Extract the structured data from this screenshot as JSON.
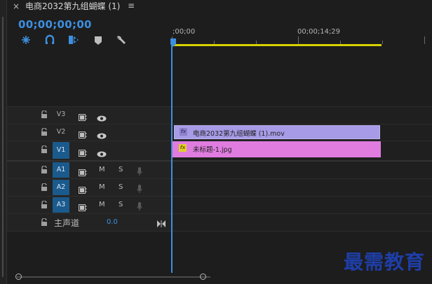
{
  "panel": {
    "close_glyph": "×",
    "title": "电商2032第九组蝴蝶 (1)",
    "menu_glyph": "≡"
  },
  "timecode": "00;00;00;00",
  "tools": [
    "snap-icon",
    "linked-selection-icon",
    "add-marker-icon",
    "marker-icon",
    "wrench-icon"
  ],
  "ruler": {
    "start": ";00;00",
    "mark": "00;00;14;29"
  },
  "tracks": {
    "video": [
      {
        "name": "V3",
        "active": false
      },
      {
        "name": "V2",
        "active": false
      },
      {
        "name": "V1",
        "active": true
      }
    ],
    "audio": [
      {
        "name": "A1",
        "m": "M",
        "s": "S"
      },
      {
        "name": "A2",
        "m": "M",
        "s": "S"
      },
      {
        "name": "A3",
        "m": "M",
        "s": "S"
      }
    ],
    "master": {
      "label": "主声道",
      "value": "0.0"
    }
  },
  "clips": {
    "v2": {
      "fx": "fx",
      "name": "电商2032第九组蝴蝶 (1).mov"
    },
    "v1": {
      "fx": "fx",
      "name": "未标题-1.jpg"
    }
  },
  "watermark": "最需教育",
  "colors": {
    "accent": "#3d8fe0",
    "v2_clip": "#a79ae6",
    "v1_clip": "#e07ce0",
    "track_target": "#1b5a8c",
    "work_area": "#d7d300"
  }
}
